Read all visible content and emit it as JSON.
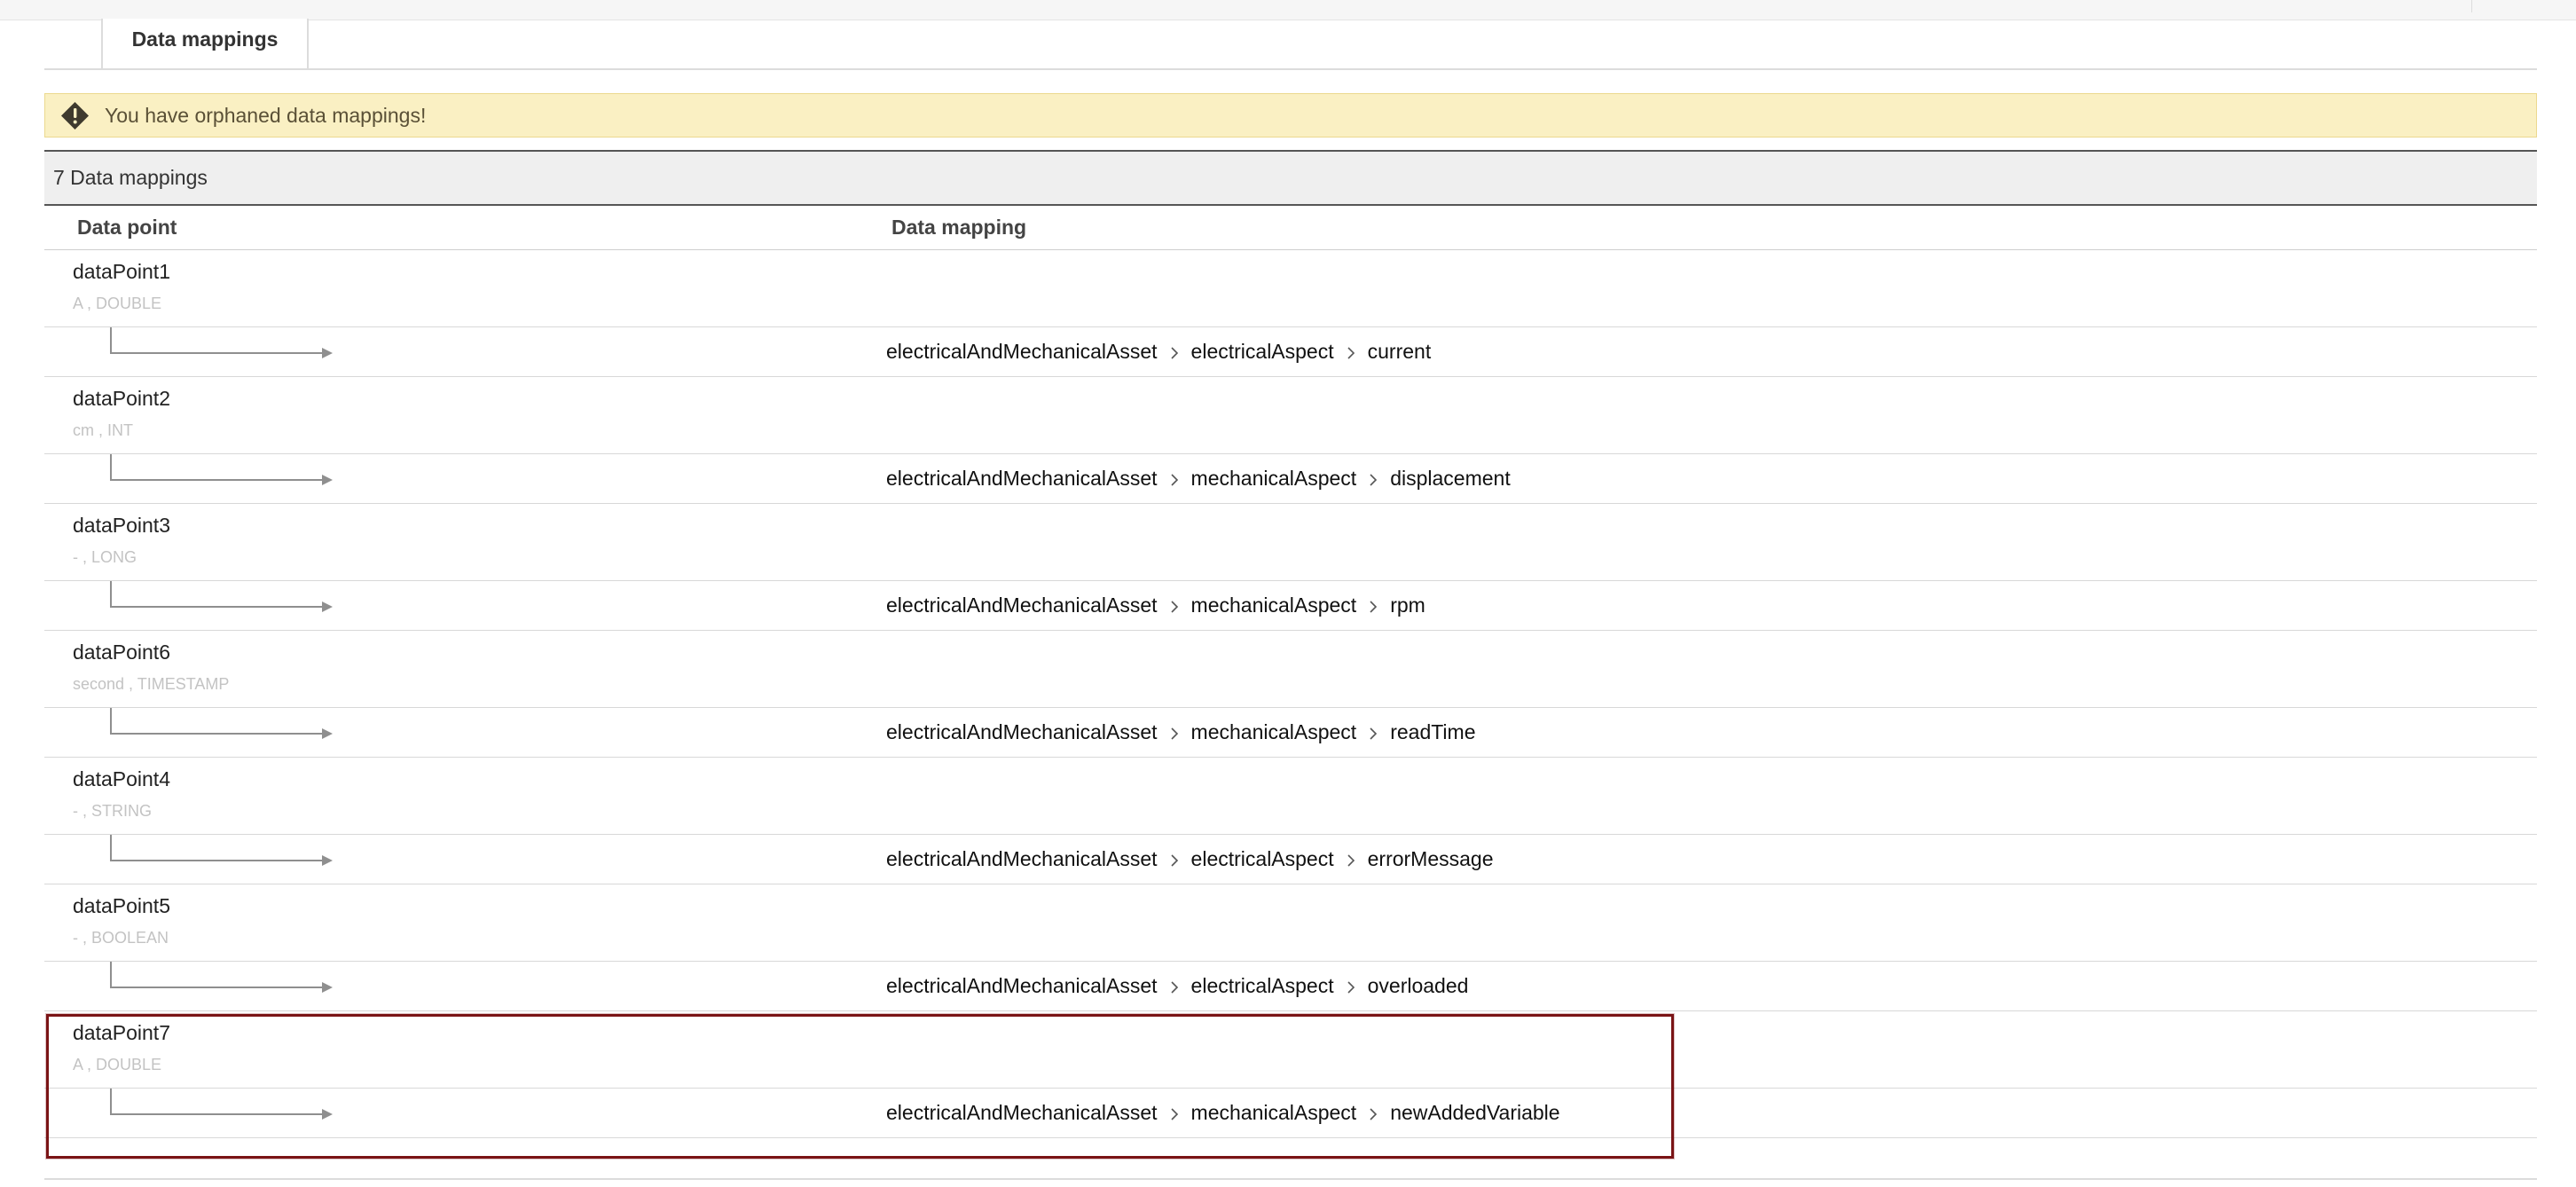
{
  "tabs": [
    {
      "label": "Data mappings",
      "active": true
    }
  ],
  "warning": {
    "icon": "warning-icon",
    "message": "You have orphaned data mappings!"
  },
  "summary": {
    "count_label": "7 Data mappings"
  },
  "columns": {
    "data_point": "Data point",
    "data_mapping": "Data mapping"
  },
  "mappings": [
    {
      "name": "dataPoint1",
      "meta": "A , DOUBLE",
      "path": [
        "electricalAndMechanicalAsset",
        "electricalAspect",
        "current"
      ]
    },
    {
      "name": "dataPoint2",
      "meta": "cm , INT",
      "path": [
        "electricalAndMechanicalAsset",
        "mechanicalAspect",
        "displacement"
      ]
    },
    {
      "name": "dataPoint3",
      "meta": "- , LONG",
      "path": [
        "electricalAndMechanicalAsset",
        "mechanicalAspect",
        "rpm"
      ]
    },
    {
      "name": "dataPoint6",
      "meta": "second , TIMESTAMP",
      "path": [
        "electricalAndMechanicalAsset",
        "mechanicalAspect",
        "readTime"
      ]
    },
    {
      "name": "dataPoint4",
      "meta": "- , STRING",
      "path": [
        "electricalAndMechanicalAsset",
        "electricalAspect",
        "errorMessage"
      ]
    },
    {
      "name": "dataPoint5",
      "meta": "- , BOOLEAN",
      "path": [
        "electricalAndMechanicalAsset",
        "electricalAspect",
        "overloaded"
      ]
    },
    {
      "name": "dataPoint7",
      "meta": "A , DOUBLE",
      "path": [
        "electricalAndMechanicalAsset",
        "mechanicalAspect",
        "newAddedVariable"
      ],
      "highlighted": true
    }
  ],
  "colors": {
    "warning_bg": "#faf0c3",
    "highlight_border": "#7a1416",
    "meta_text": "#c3c3c3"
  }
}
